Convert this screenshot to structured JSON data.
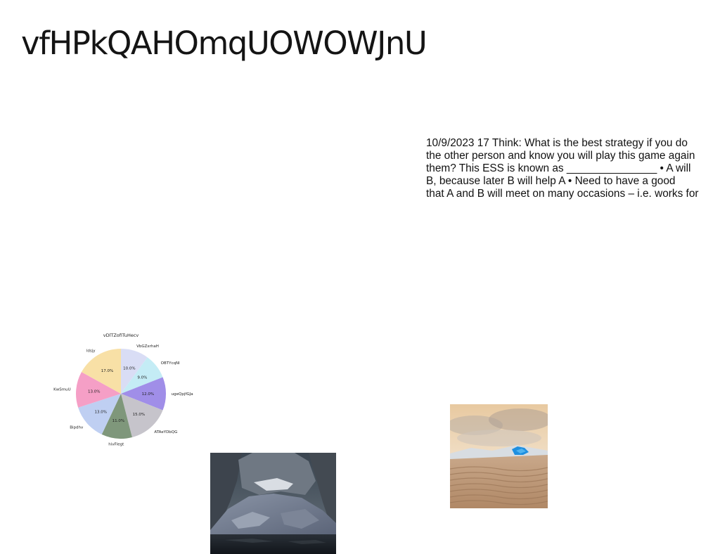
{
  "page": {
    "title": "vfHPkQAHOmqUOWOWJnU"
  },
  "text_block": {
    "lines": [
      "10/9/2023 17 Think: What is the best strategy if you do",
      "the other person and know you will play this game again",
      "them? This ESS is known as _______________ • A will",
      "B, because later B will help A • Need to have a good",
      "that A and B will meet on many occasions – i.e. works for"
    ]
  },
  "chart_data": {
    "type": "pie",
    "title": "vDlTZofiTuHecv",
    "categories": [
      "VbGZxrhaH",
      "OBTYcqNl",
      "ugeQpjfGJa",
      "ATAeYDbQG",
      "hivFlegt",
      "Bipdhv",
      "KwSmuU",
      "ldsjy"
    ],
    "values": [
      10.0,
      9.0,
      12.0,
      15.0,
      11.0,
      13.0,
      13.0,
      17.0
    ],
    "value_labels": [
      "10.0%",
      "9.0%",
      "12.0%",
      "15.0%",
      "11.0%",
      "13.0%",
      "13.0%",
      "17.0%"
    ],
    "colors": [
      "#d9ddf5",
      "#c4ecf5",
      "#a08ee8",
      "#c6c4cb",
      "#7f977b",
      "#bfcff2",
      "#f59fc6",
      "#f8e0a6"
    ],
    "start_angle_deg": 90,
    "direction": "clockwise",
    "legend": "none"
  },
  "images": {
    "mountain_photo": "mountain-lake-photo",
    "dunes_photo": "sand-dunes-photo"
  }
}
